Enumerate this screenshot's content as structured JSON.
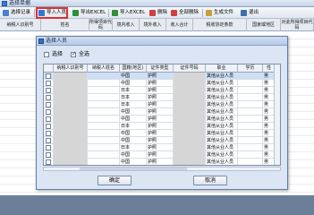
{
  "window": {
    "title": "选择单据"
  },
  "toolbar": {
    "buttons": [
      {
        "label": "选择记录",
        "icon": "select-icon",
        "color": "#4a7fd0"
      },
      {
        "label": "导入人员",
        "icon": "import-icon",
        "color": "#2f78d8"
      },
      {
        "label": "导出EXCEL",
        "icon": "excel-export-icon",
        "color": "#2f8f3a"
      },
      {
        "label": "导入EXCEL",
        "icon": "excel-import-icon",
        "color": "#2f8f3a"
      },
      {
        "label": "删除",
        "icon": "delete-icon",
        "color": "#d04040"
      },
      {
        "label": "全部删除",
        "icon": "delete-all-icon",
        "color": "#d04040"
      },
      {
        "label": "生成文件",
        "icon": "generate-file-icon",
        "color": "#c9a237"
      },
      {
        "label": "退出",
        "icon": "exit-icon",
        "color": "#3f6fb0"
      }
    ]
  },
  "columns": [
    "纳税人识别号",
    "姓名",
    "所得项目代码",
    "境内收入",
    "境外收入",
    "收入合计",
    "税收协定条款",
    "国家或地区",
    "对此所得项目代码"
  ],
  "dialog": {
    "title": "选择人员",
    "options": [
      {
        "label": "选择",
        "checked": false
      },
      {
        "label": "全选",
        "checked": true
      }
    ],
    "grid": {
      "headers": [
        "",
        "纳税人识别号",
        "纳税人姓名",
        "国籍(地区)",
        "证件类型",
        "证件号码",
        "职业",
        "学历",
        "性"
      ],
      "rows": [
        [
          "",
          "中国",
          "护照",
          "其他从业人员",
          "",
          "男"
        ],
        [
          "",
          "中国",
          "护照",
          "其他从业人员",
          "",
          "男"
        ],
        [
          "",
          "日本",
          "护照",
          "其他从业人员",
          "",
          "男"
        ],
        [
          "",
          "日本",
          "护照",
          "其他从业人员",
          "",
          "男"
        ],
        [
          "",
          "日本",
          "护照",
          "其他从业人员",
          "",
          "男"
        ],
        [
          "",
          "中国",
          "护照",
          "其他从业人员",
          "",
          "男"
        ],
        [
          "",
          "中国",
          "护照",
          "其他从业人员",
          "",
          "男"
        ],
        [
          "",
          "日本",
          "护照",
          "其他从业人员",
          "",
          "男"
        ],
        [
          "",
          "中国",
          "护照",
          "其他从业人员",
          "",
          "男"
        ],
        [
          "",
          "中国",
          "护照",
          "其他从业人员",
          "",
          "男"
        ],
        [
          "",
          "日本",
          "护照",
          "其他从业人员",
          "",
          "男"
        ],
        [
          "",
          "中国",
          "护照",
          "其他从业人员",
          "",
          "男"
        ],
        [
          "",
          "中国",
          "护照",
          "其他从业人员",
          "",
          "男"
        ]
      ]
    },
    "confirm_label": "确定",
    "cancel_label": "取消"
  }
}
